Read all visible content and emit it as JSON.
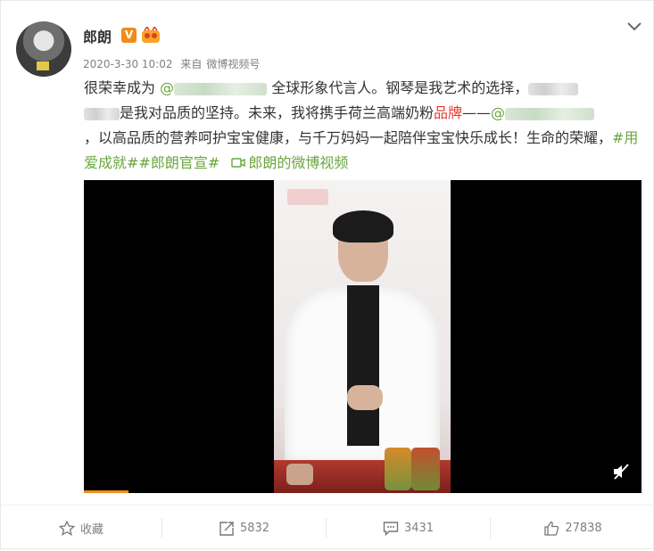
{
  "post": {
    "author": "郎朗",
    "verified_badge": "V",
    "time": "2020-3-30 10:02",
    "source_prefix": "来自",
    "source": "微博视频号",
    "text": {
      "l1_a": "很荣幸成为",
      "mention1": "@",
      "l1_b": "全球形象代言人。钢琴是我艺术的选择，",
      "l2_a": "是我对品质的坚持。未来，我将携手荷兰高端奶粉",
      "l2_red": "品牌",
      "l2_b": "——",
      "mention2": "@",
      "l3": "，以高品质的营养呵护宝宝健康，与千万妈妈一起陪伴宝宝快乐成长！生命的荣耀，",
      "tags": "#用爱成就##郎朗官宣#",
      "video_link": "郎朗的微博视频"
    },
    "video": {
      "progress": 0.08,
      "muted": true
    }
  },
  "actions": {
    "favorite": "收藏",
    "repost": "5832",
    "comment": "3431",
    "like": "27838"
  },
  "icons": [
    "chevron-down-icon",
    "star-icon",
    "share-icon",
    "comment-icon",
    "like-icon",
    "mute-icon",
    "video-icon"
  ],
  "colors": {
    "link": "#6aa53f",
    "accent": "#f08c1a",
    "brand_red": "#e5392e"
  }
}
